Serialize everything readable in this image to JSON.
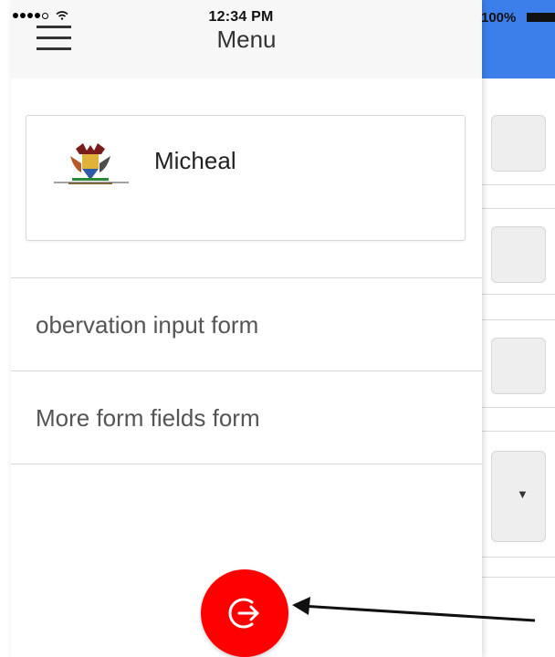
{
  "status_bar": {
    "time": "12:34 PM",
    "battery": "100%"
  },
  "drawer": {
    "title": "Menu",
    "profile": {
      "name": "Micheal",
      "logo_icon": "university-crest-icon"
    },
    "menu_items": [
      {
        "label": "obervation input form"
      },
      {
        "label": "More form fields form"
      }
    ],
    "logout_icon": "logout-arrow-icon"
  },
  "colors": {
    "header_blue": "#3d7fea",
    "logout_red": "#ff0000",
    "drawer_header_bg": "#f7f7f7"
  },
  "background_form": {
    "select_arrow": "▼"
  }
}
